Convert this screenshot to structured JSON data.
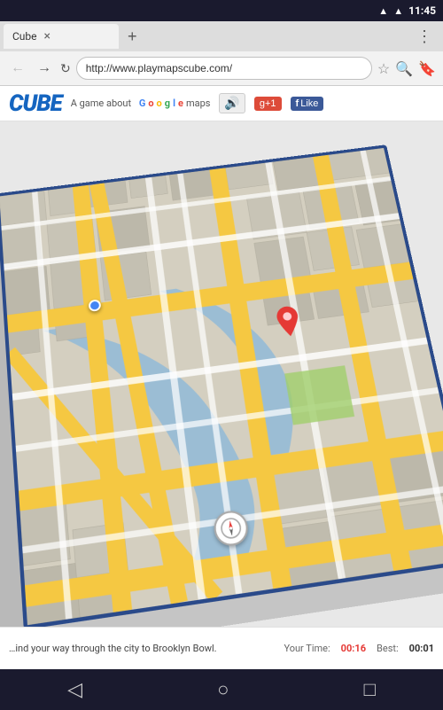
{
  "statusBar": {
    "time": "11:45",
    "wifiIcon": "▲",
    "batteryIcon": "▮"
  },
  "tabBar": {
    "activeTab": {
      "label": "Cube",
      "closeIcon": "×"
    },
    "newTabIcon": "+",
    "menuIcon": "⋮"
  },
  "addressBar": {
    "backIcon": "←",
    "forwardIcon": "→",
    "refreshIcon": "↻",
    "sslIcon": "🔒",
    "url": "http://www.playmapscube.com/",
    "starIcon": "☆",
    "searchIcon": "🔍",
    "bookmarkIcon": "🔖"
  },
  "pageHeader": {
    "cubeLogo": "CUBE",
    "tagline": "A game about",
    "googleText": "Google",
    "mapsText": " maps",
    "soundIcon": "🔊",
    "gplusLabel": "g+1",
    "fbLikeLabel": "Like"
  },
  "map": {
    "compassIcon": "◎",
    "blueMarkerTitle": "Current location",
    "redMarkerTitle": "Destination"
  },
  "bottomBar": {
    "instruction": "ind your way through the city to Brooklyn Bowl.",
    "yourTimeLabel": "Your Time:",
    "yourTimeValue": "00:16",
    "bestLabel": "Best:",
    "bestValue": "00:01"
  },
  "navBar": {
    "backIcon": "◁",
    "homeIcon": "○",
    "menuIcon": "□"
  }
}
